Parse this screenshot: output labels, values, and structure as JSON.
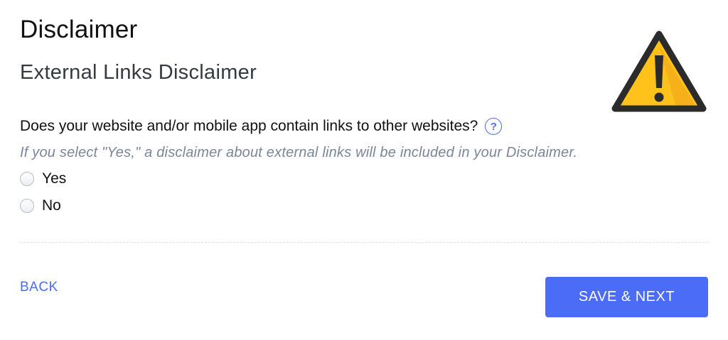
{
  "page": {
    "title": "Disclaimer",
    "section_title": "External Links Disclaimer"
  },
  "question": {
    "text": "Does your website and/or mobile app contain links to other websites?",
    "help_icon": "question-mark-icon",
    "help_glyph": "?",
    "hint": "If you select \"Yes,\" a disclaimer about external links will be included in your Disclaimer.",
    "options": [
      {
        "label": "Yes",
        "selected": false
      },
      {
        "label": "No",
        "selected": false
      }
    ]
  },
  "illustration": {
    "icon": "warning-triangle-icon",
    "colors": {
      "fill": "#ffc21a",
      "shade": "#f3a91a",
      "stroke": "#2b2b2b"
    }
  },
  "footer": {
    "back_label": "BACK",
    "next_label": "SAVE & NEXT"
  },
  "colors": {
    "accent": "#4a6cf7",
    "hint": "#7a8699",
    "divider": "#dfe2e6"
  }
}
